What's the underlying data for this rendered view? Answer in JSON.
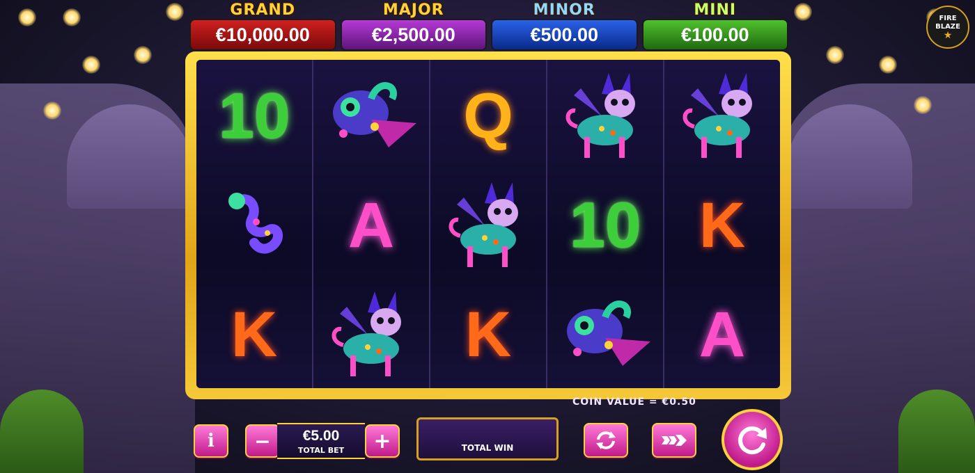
{
  "jackpots": [
    {
      "name": "GRAND",
      "amount": "€10,000.00"
    },
    {
      "name": "MAJOR",
      "amount": "€2,500.00"
    },
    {
      "name": "MINOR",
      "amount": "€500.00"
    },
    {
      "name": "MINI",
      "amount": "€100.00"
    }
  ],
  "logo": {
    "line1": "FIRE",
    "line2": "BLAZE",
    "icon": "star-icon"
  },
  "reels": [
    [
      "10",
      "lizard",
      "K"
    ],
    [
      "chameleon",
      "A",
      "dog"
    ],
    [
      "Q",
      "dog",
      "K"
    ],
    [
      "dog",
      "10",
      "chameleon"
    ],
    [
      "dog",
      "K",
      "A"
    ]
  ],
  "coin_value": "COIN VALUE = €0.50",
  "controls": {
    "info_label": "i",
    "minus_label": "−",
    "plus_label": "+",
    "bet_value": "€5.00",
    "bet_label": "TOTAL BET",
    "win_label": "TOTAL WIN",
    "autoplay_icon": "autoplay-icon",
    "turbo_icon": "turbo-icon",
    "spin_icon": "spin-icon"
  },
  "colors": {
    "grand": "#b01515",
    "major": "#8a24b0",
    "minor": "#1a44c0",
    "mini": "#34a020",
    "frame": "#f0c030",
    "button": "#e040b0"
  }
}
